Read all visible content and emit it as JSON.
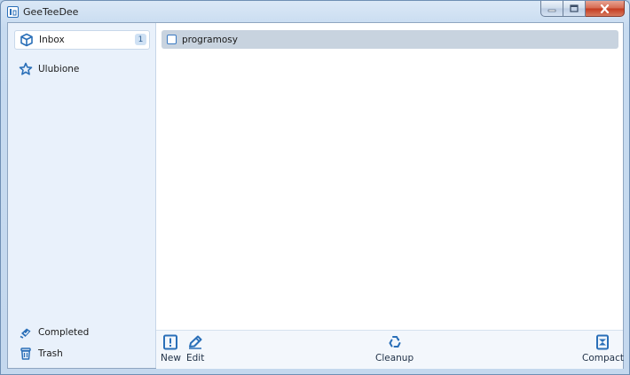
{
  "window": {
    "title": "GeeTeeDee",
    "controls": {
      "minimize": "minimize",
      "maximize": "maximize",
      "close": "close"
    }
  },
  "sidebar": {
    "top_items": [
      {
        "label": "Inbox",
        "icon": "box-icon",
        "count": "1",
        "selected": true
      },
      {
        "label": "Ulubione",
        "icon": "star-icon"
      }
    ],
    "bottom_items": [
      {
        "label": "Completed",
        "icon": "completed-icon"
      },
      {
        "label": "Trash",
        "icon": "trash-icon"
      }
    ]
  },
  "tasks": [
    {
      "title": "programosy",
      "done": false
    }
  ],
  "toolbar": {
    "new_label": "New",
    "edit_label": "Edit",
    "cleanup_label": "Cleanup",
    "compact_label": "Compact"
  },
  "colors": {
    "accent": "#2a6fb8",
    "selection": "#c8d3df",
    "sidebar_bg": "#e9f1fb"
  }
}
